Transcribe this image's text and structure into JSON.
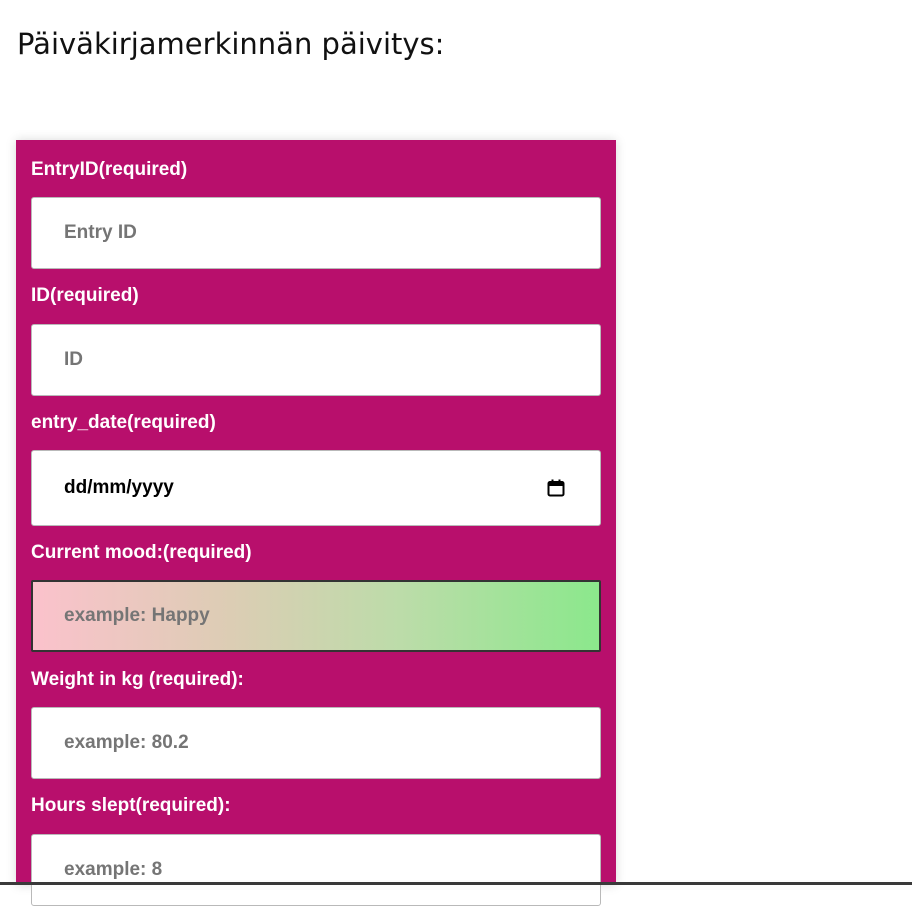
{
  "page": {
    "title": "Päiväkirjamerkinnän päivitys:"
  },
  "form": {
    "fields": [
      {
        "label": "EntryID(required)",
        "placeholder": "Entry ID"
      },
      {
        "label": "ID(required)",
        "placeholder": "ID"
      },
      {
        "label": "entry_date(required)",
        "value": "dd/mm/yyyy"
      },
      {
        "label": "Current mood:(required)",
        "placeholder": "example: Happy"
      },
      {
        "label": "Weight in kg (required):",
        "placeholder": "example: 80.2"
      },
      {
        "label": "Hours slept(required):",
        "placeholder": "example: 8"
      }
    ],
    "icons": {
      "date_picker": "calendar-icon"
    },
    "colors": {
      "panel_background": "#b80f6c",
      "mood_gradient_start": "#fbc2cc",
      "mood_gradient_end": "#8be88c"
    }
  }
}
